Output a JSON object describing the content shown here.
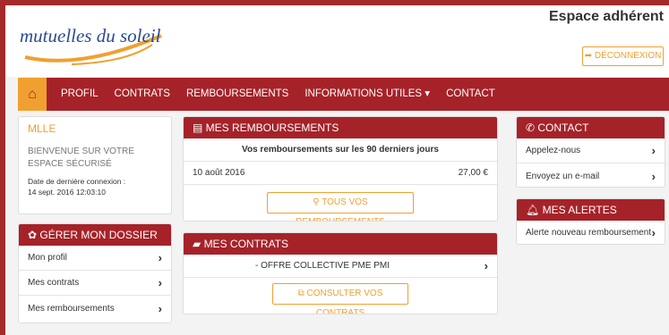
{
  "brand": {
    "logo_text": "mutuelles du soleil"
  },
  "header": {
    "espace_title": "Espace adhérent",
    "logout_label": "DÉCONNEXION"
  },
  "nav": {
    "items": [
      "PROFIL",
      "CONTRATS",
      "REMBOURSEMENTS",
      "INFORMATIONS UTILES ▾",
      "CONTACT"
    ]
  },
  "welcome": {
    "title": "MLLE",
    "text": "BIENVENUE SUR VOTRE ESPACE SÉCURISÉ",
    "last_login_label": "Date de dernière connexion :",
    "last_login_value": "14 sept. 2016 12:03:10"
  },
  "dossier": {
    "title": "GÉRER MON DOSSIER",
    "items": [
      "Mon profil",
      "Mes contrats",
      "Mes remboursements"
    ]
  },
  "remboursements": {
    "title": "MES REMBOURSEMENTS",
    "subtitle": "Vos remboursements sur les 90 derniers jours",
    "row_date": "10 août 2016",
    "row_amount": "27,00 €",
    "button": "TOUS VOS REMBOURSEMENTS"
  },
  "contrats": {
    "title": "MES CONTRATS",
    "item": "- OFFRE COLLECTIVE PME PMI",
    "button": "CONSULTER VOS CONTRATS"
  },
  "contact": {
    "title": "CONTACT",
    "items": [
      "Appelez-nous",
      "Envoyez un e-mail"
    ]
  },
  "alertes": {
    "title": "MES ALERTES",
    "item": "Alerte nouveau remboursement"
  },
  "colors": {
    "primary": "#a62229",
    "accent": "#f0a030",
    "logo_blue": "#2a4a95"
  }
}
